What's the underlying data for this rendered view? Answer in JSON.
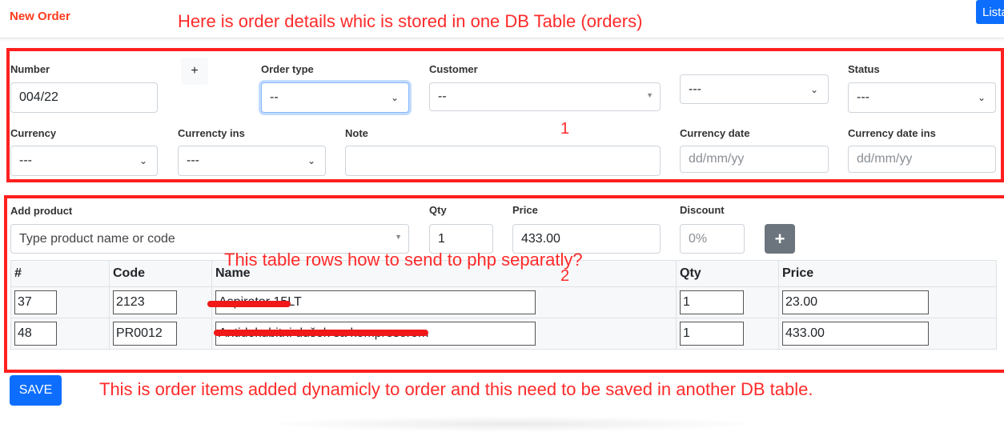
{
  "header": {
    "title": "New Order",
    "lista_button": "Lista"
  },
  "annotations": {
    "top": "Here is order details whic is stored in one DB Table (orders)",
    "box1": "1",
    "table_q": "This table rows how to send to php separatly?",
    "box2": "2",
    "bottom": "This is order items added dynamicly to order and this need to be saved in another DB table."
  },
  "order": {
    "number": {
      "label": "Number",
      "value": "004/22"
    },
    "plus": "+",
    "order_type": {
      "label": "Order type",
      "value": "--"
    },
    "customer": {
      "label": "Customer",
      "value": "--"
    },
    "unlabeled_select": {
      "value": "---"
    },
    "status": {
      "label": "Status",
      "value": "---"
    },
    "currency": {
      "label": "Currency",
      "value": "---"
    },
    "currency_ins": {
      "label": "Currencty ins",
      "value": "---"
    },
    "note": {
      "label": "Note",
      "value": ""
    },
    "currency_date": {
      "label": "Currency date",
      "placeholder": "dd/mm/yy"
    },
    "currency_date_ins": {
      "label": "Currency date ins",
      "placeholder": "dd/mm/yy"
    }
  },
  "add_product": {
    "label": "Add product",
    "placeholder": "Type product name or code",
    "qty_label": "Qty",
    "qty": "1",
    "price_label": "Price",
    "price": "433.00",
    "discount_label": "Discount",
    "discount_placeholder": "0%",
    "add": "+"
  },
  "items": {
    "columns": [
      "#",
      "Code",
      "Name",
      "Qty",
      "Price"
    ],
    "rows": [
      {
        "id": "37",
        "code": "2123",
        "name": "Aspirator 15LT",
        "qty": "1",
        "price": "23.00"
      },
      {
        "id": "48",
        "code": "PR0012",
        "name": "Antidekubitni dušek sa kompresorom",
        "qty": "1",
        "price": "433.00"
      }
    ]
  },
  "save_label": "SAVE",
  "colors": {
    "annotation": "#ff1f1f",
    "primary": "#0d6efd",
    "title": "#ff3b1f"
  }
}
